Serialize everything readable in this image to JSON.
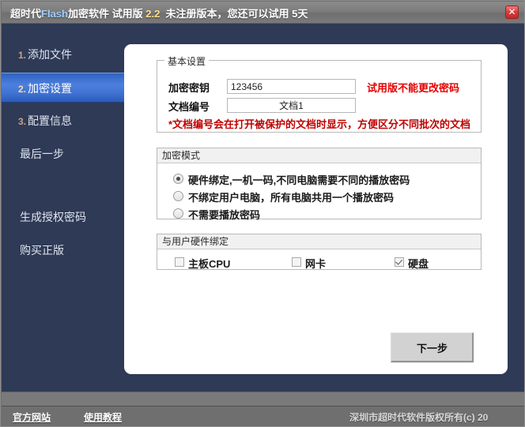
{
  "window": {
    "title_prefix": "超时代",
    "title_brand": "Flash",
    "title_mid": "加密软件 试用版",
    "title_version": "2.2",
    "title_suffix": "未注册版本，您还可以试用 5天",
    "close_glyph": "✕"
  },
  "sidebar": {
    "items": [
      {
        "num": "1.",
        "label": "添加文件",
        "active": false
      },
      {
        "num": "2.",
        "label": "加密设置",
        "active": true
      },
      {
        "num": "3.",
        "label": "配置信息",
        "active": false
      },
      {
        "num": "",
        "label": "最后一步",
        "active": false
      },
      {
        "num": "",
        "label": "生成授权密码",
        "active": false
      },
      {
        "num": "",
        "label": "购买正版",
        "active": false
      }
    ]
  },
  "basic_settings": {
    "legend": "基本设置",
    "key_label": "加密密钥",
    "key_value": "123456",
    "key_placeholder": "",
    "docno_label": "文档编号",
    "docno_value": "文档1",
    "docno_placeholder": "",
    "trial_warning": "试用版不能更改密码",
    "note": "*文档编号会在打开被保护的文档时显示，方便区分不同批次的文档"
  },
  "encrypt_mode": {
    "title": "加密模式",
    "options": [
      {
        "label": "硬件绑定,一机一码,不同电脑需要不同的播放密码",
        "checked": true
      },
      {
        "label": "不绑定用户电脑，所有电脑共用一个播放密码",
        "checked": false
      },
      {
        "label": "不需要播放密码",
        "checked": false
      }
    ]
  },
  "hardware_binding": {
    "title": "与用户硬件绑定",
    "options": [
      {
        "label": "主板CPU",
        "checked": false
      },
      {
        "label": "网卡",
        "checked": false
      },
      {
        "label": "硬盘",
        "checked": true
      }
    ]
  },
  "actions": {
    "next_label": "下一步"
  },
  "footer": {
    "official_site": "官方网站",
    "tutorial": "使用教程",
    "copyright": "深圳市超时代软件版权所有(c) 20"
  },
  "colors": {
    "window_frame": "#6e6e6e",
    "dark_panel": "#2e3a56",
    "nav_active": "#3f72d2",
    "accent_red": "#e50000",
    "note_red": "#c00000",
    "card_bg": "#ffffff"
  }
}
